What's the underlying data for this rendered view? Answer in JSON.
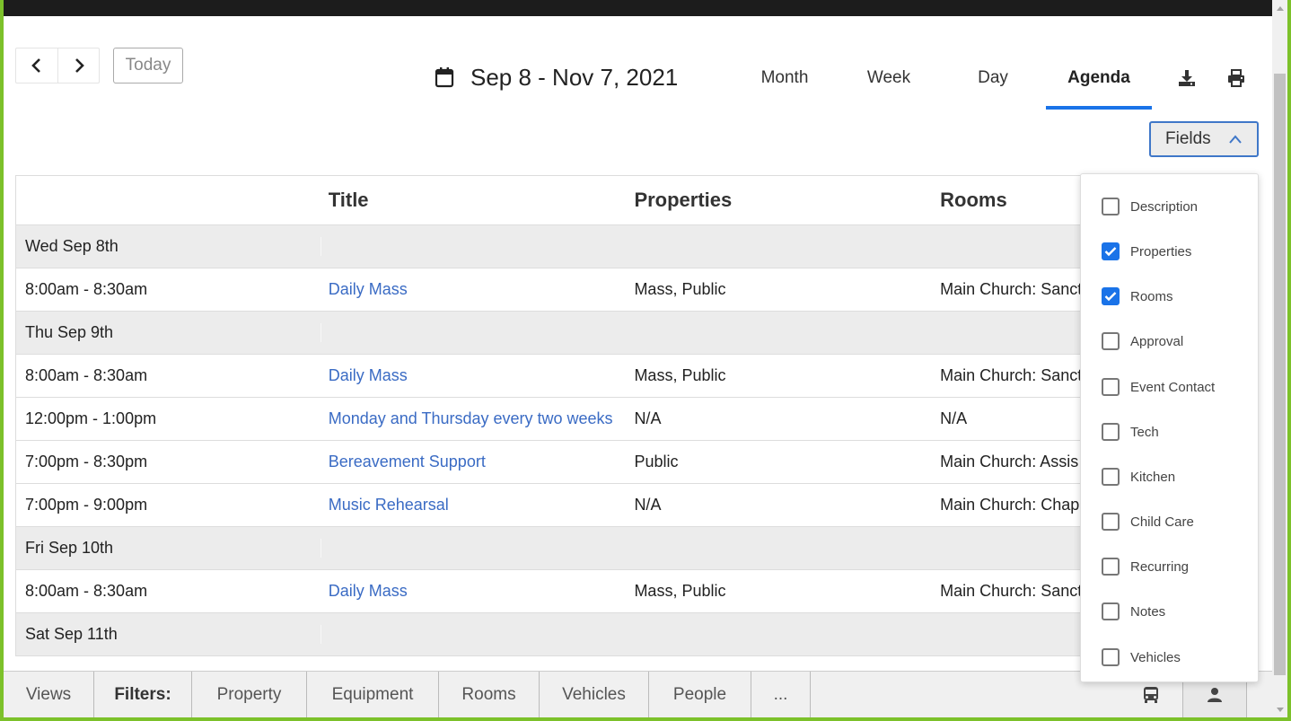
{
  "nav": {
    "today_label": "Today"
  },
  "date_range": {
    "text": "Sep 8 - Nov 7, 2021"
  },
  "views": {
    "month": "Month",
    "week": "Week",
    "day": "Day",
    "agenda": "Agenda",
    "active": "Agenda"
  },
  "toolbar_icons": [
    "download-icon",
    "print-icon"
  ],
  "fields_button": {
    "label": "Fields"
  },
  "table": {
    "headers": [
      "",
      "Title",
      "Properties",
      "Rooms"
    ],
    "rows": [
      {
        "type": "day",
        "time": "Wed Sep 8th"
      },
      {
        "type": "event",
        "time": "8:00am - 8:30am",
        "title": "Daily Mass",
        "properties": "Mass, Public",
        "rooms": "Main Church: Sanct"
      },
      {
        "type": "day",
        "time": "Thu Sep 9th"
      },
      {
        "type": "event",
        "time": "8:00am - 8:30am",
        "title": "Daily Mass",
        "properties": "Mass, Public",
        "rooms": "Main Church: Sanct"
      },
      {
        "type": "event",
        "time": "12:00pm - 1:00pm",
        "title": "Monday and Thursday every two weeks",
        "properties": "N/A",
        "rooms": "N/A"
      },
      {
        "type": "event",
        "time": "7:00pm - 8:30pm",
        "title": "Bereavement Support",
        "properties": "Public",
        "rooms": "Main Church: Assis"
      },
      {
        "type": "event",
        "time": "7:00pm - 9:00pm",
        "title": "Music Rehearsal",
        "properties": "N/A",
        "rooms": "Main Church: Chap"
      },
      {
        "type": "day",
        "time": "Fri Sep 10th"
      },
      {
        "type": "event",
        "time": "8:00am - 8:30am",
        "title": "Daily Mass",
        "properties": "Mass, Public",
        "rooms": "Main Church: Sanct"
      },
      {
        "type": "day",
        "time": "Sat Sep 11th"
      }
    ]
  },
  "fields_dropdown": {
    "items": [
      {
        "label": "Description",
        "checked": false
      },
      {
        "label": "Properties",
        "checked": true
      },
      {
        "label": "Rooms",
        "checked": true
      },
      {
        "label": "Approval",
        "checked": false
      },
      {
        "label": "Event Contact",
        "checked": false
      },
      {
        "label": "Tech",
        "checked": false
      },
      {
        "label": "Kitchen",
        "checked": false
      },
      {
        "label": "Child Care",
        "checked": false
      },
      {
        "label": "Recurring",
        "checked": false
      },
      {
        "label": "Notes",
        "checked": false
      },
      {
        "label": "Vehicles",
        "checked": false
      }
    ],
    "accent_color": "#1a73e8"
  },
  "bottom_bar": {
    "views_label": "Views",
    "filters_label": "Filters:",
    "filters": [
      "Property",
      "Equipment",
      "Rooms",
      "Vehicles",
      "People",
      "..."
    ],
    "right_icons": [
      "bus-icon",
      "person-icon"
    ]
  },
  "colors": {
    "link": "#3a6bc4",
    "active_tab": "#1a73e8",
    "frame": "#7cc12a"
  }
}
